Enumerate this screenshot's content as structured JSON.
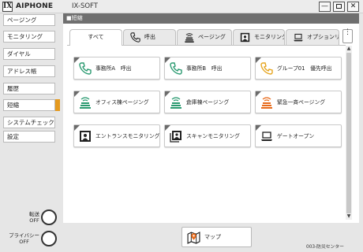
{
  "window": {
    "logo_glyph": "IX",
    "brand": "AIPHONE",
    "product": "IX-SOFT",
    "min_glyph": "—",
    "close_glyph": "✕"
  },
  "sidebar": {
    "items": [
      {
        "label": "ページング",
        "active": false
      },
      {
        "label": "モニタリング",
        "active": false
      },
      {
        "label": "ダイヤル",
        "active": false
      },
      {
        "label": "アドレス帳",
        "active": false
      },
      {
        "label": "履歴",
        "active": false
      },
      {
        "label": "短縮",
        "active": true
      },
      {
        "label": "システムチェック",
        "active": false
      },
      {
        "label": "設定",
        "active": false
      }
    ],
    "transfer": {
      "line1": "転送",
      "line2": "OFF"
    },
    "privacy": {
      "line1": "プライバシー",
      "line2": "OFF"
    }
  },
  "panel": {
    "header": "■短縮"
  },
  "tabs": [
    {
      "label": "すべて",
      "icon": "none"
    },
    {
      "label": "呼出",
      "icon": "phone-icon"
    },
    {
      "label": "ページング",
      "icon": "speaker-icon"
    },
    {
      "label": "モニタリング",
      "icon": "monitor-person-icon"
    },
    {
      "label": "オプションリレー",
      "icon": "laptop-icon"
    }
  ],
  "tab_more": "⋮",
  "buttons": [
    {
      "label": "事務所A　呼出",
      "icon": "phone-icon",
      "color": "#2a9a70"
    },
    {
      "label": "事務所B　呼出",
      "icon": "phone-icon",
      "color": "#2a9a70"
    },
    {
      "label": "グループ01　優先呼出",
      "icon": "phone-icon",
      "color": "#e6a51e"
    },
    {
      "label": "オフィス棟ページング",
      "icon": "speaker-icon",
      "color": "#2a9a70"
    },
    {
      "label": "倉庫棟ページング",
      "icon": "speaker-icon",
      "color": "#2a9a70"
    },
    {
      "label": "緊急一斉ページング",
      "icon": "speaker-icon",
      "color": "#e86a1a"
    },
    {
      "label": "エントランスモニタリング",
      "icon": "monitor-person-icon",
      "color": "#222222"
    },
    {
      "label": "スキャンモニタリング",
      "icon": "scan-monitor-icon",
      "color": "#222222"
    },
    {
      "label": "ゲートオープン",
      "icon": "laptop-icon",
      "color": "#222222"
    }
  ],
  "scroll": {
    "up": "▲",
    "down": "▼"
  },
  "map_button": {
    "label": "マップ",
    "icon": "map-pin-icon"
  },
  "station_name": "003-防災センター"
}
